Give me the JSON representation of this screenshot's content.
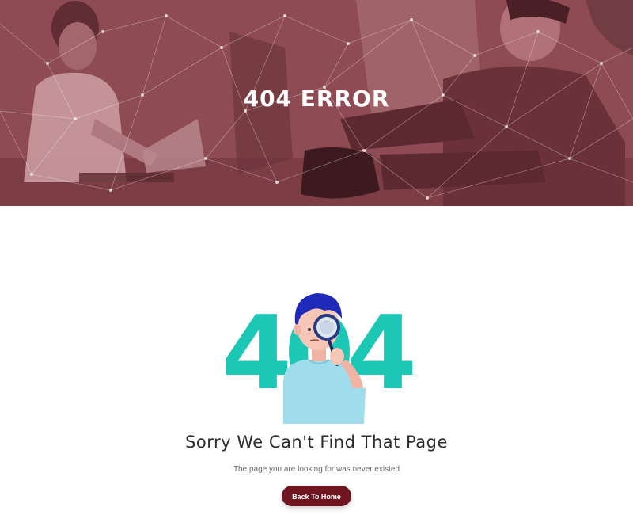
{
  "hero": {
    "title": "404 ERROR",
    "overlay_color": "#8d4b52"
  },
  "illustration": {
    "digits": [
      "4",
      "0",
      "4"
    ],
    "digit_color": "#1cc7b5",
    "shirt_color": "#9fdcec",
    "hair_color": "#1f2bb8"
  },
  "message": {
    "heading": "Sorry We Can't Find That Page",
    "subtext": "The page you are looking for was never existed"
  },
  "button": {
    "label": "Back To Home",
    "color": "#6f1620"
  }
}
